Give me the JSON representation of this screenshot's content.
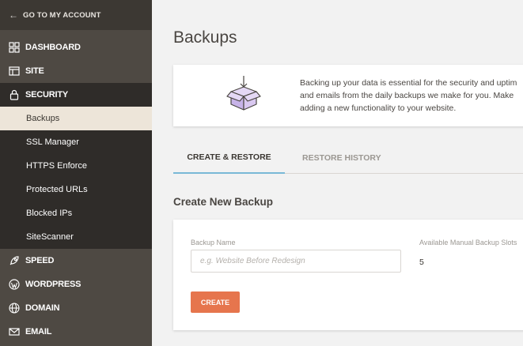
{
  "sidebar": {
    "back_label": "GO TO MY ACCOUNT",
    "items": [
      {
        "label": "DASHBOARD",
        "icon": "grid-icon"
      },
      {
        "label": "SITE",
        "icon": "browser-icon"
      },
      {
        "label": "SECURITY",
        "icon": "lock-icon"
      }
    ],
    "security_sub": [
      {
        "label": "Backups",
        "active": true
      },
      {
        "label": "SSL Manager"
      },
      {
        "label": "HTTPS Enforce"
      },
      {
        "label": "Protected URLs"
      },
      {
        "label": "Blocked IPs"
      },
      {
        "label": "SiteScanner"
      }
    ],
    "items_after": [
      {
        "label": "SPEED",
        "icon": "rocket-icon"
      },
      {
        "label": "WORDPRESS",
        "icon": "wordpress-icon"
      },
      {
        "label": "DOMAIN",
        "icon": "globe-icon"
      },
      {
        "label": "EMAIL",
        "icon": "envelope-icon"
      }
    ]
  },
  "main": {
    "title": "Backups",
    "info_lines": [
      "Backing up your data is essential for the security and uptim",
      "and emails from the daily backups we make for you. Make",
      "adding a new functionality to your website."
    ],
    "tabs": [
      "CREATE & RESTORE",
      "RESTORE HISTORY"
    ],
    "section_title": "Create New Backup",
    "form": {
      "name_label": "Backup Name",
      "name_placeholder": "e.g. Website Before Redesign",
      "name_value": "",
      "slots_label": "Available Manual Backup Slots",
      "slots_value": "5",
      "create_label": "CREATE"
    }
  },
  "colors": {
    "sidebar_bg": "#4e4943",
    "sidebar_dark": "#2f2c29",
    "active_sub_bg": "#ede5d9",
    "accent_tab": "#79b8d6",
    "create_button": "#e6754d",
    "box_icon": "#c7b3e8"
  }
}
